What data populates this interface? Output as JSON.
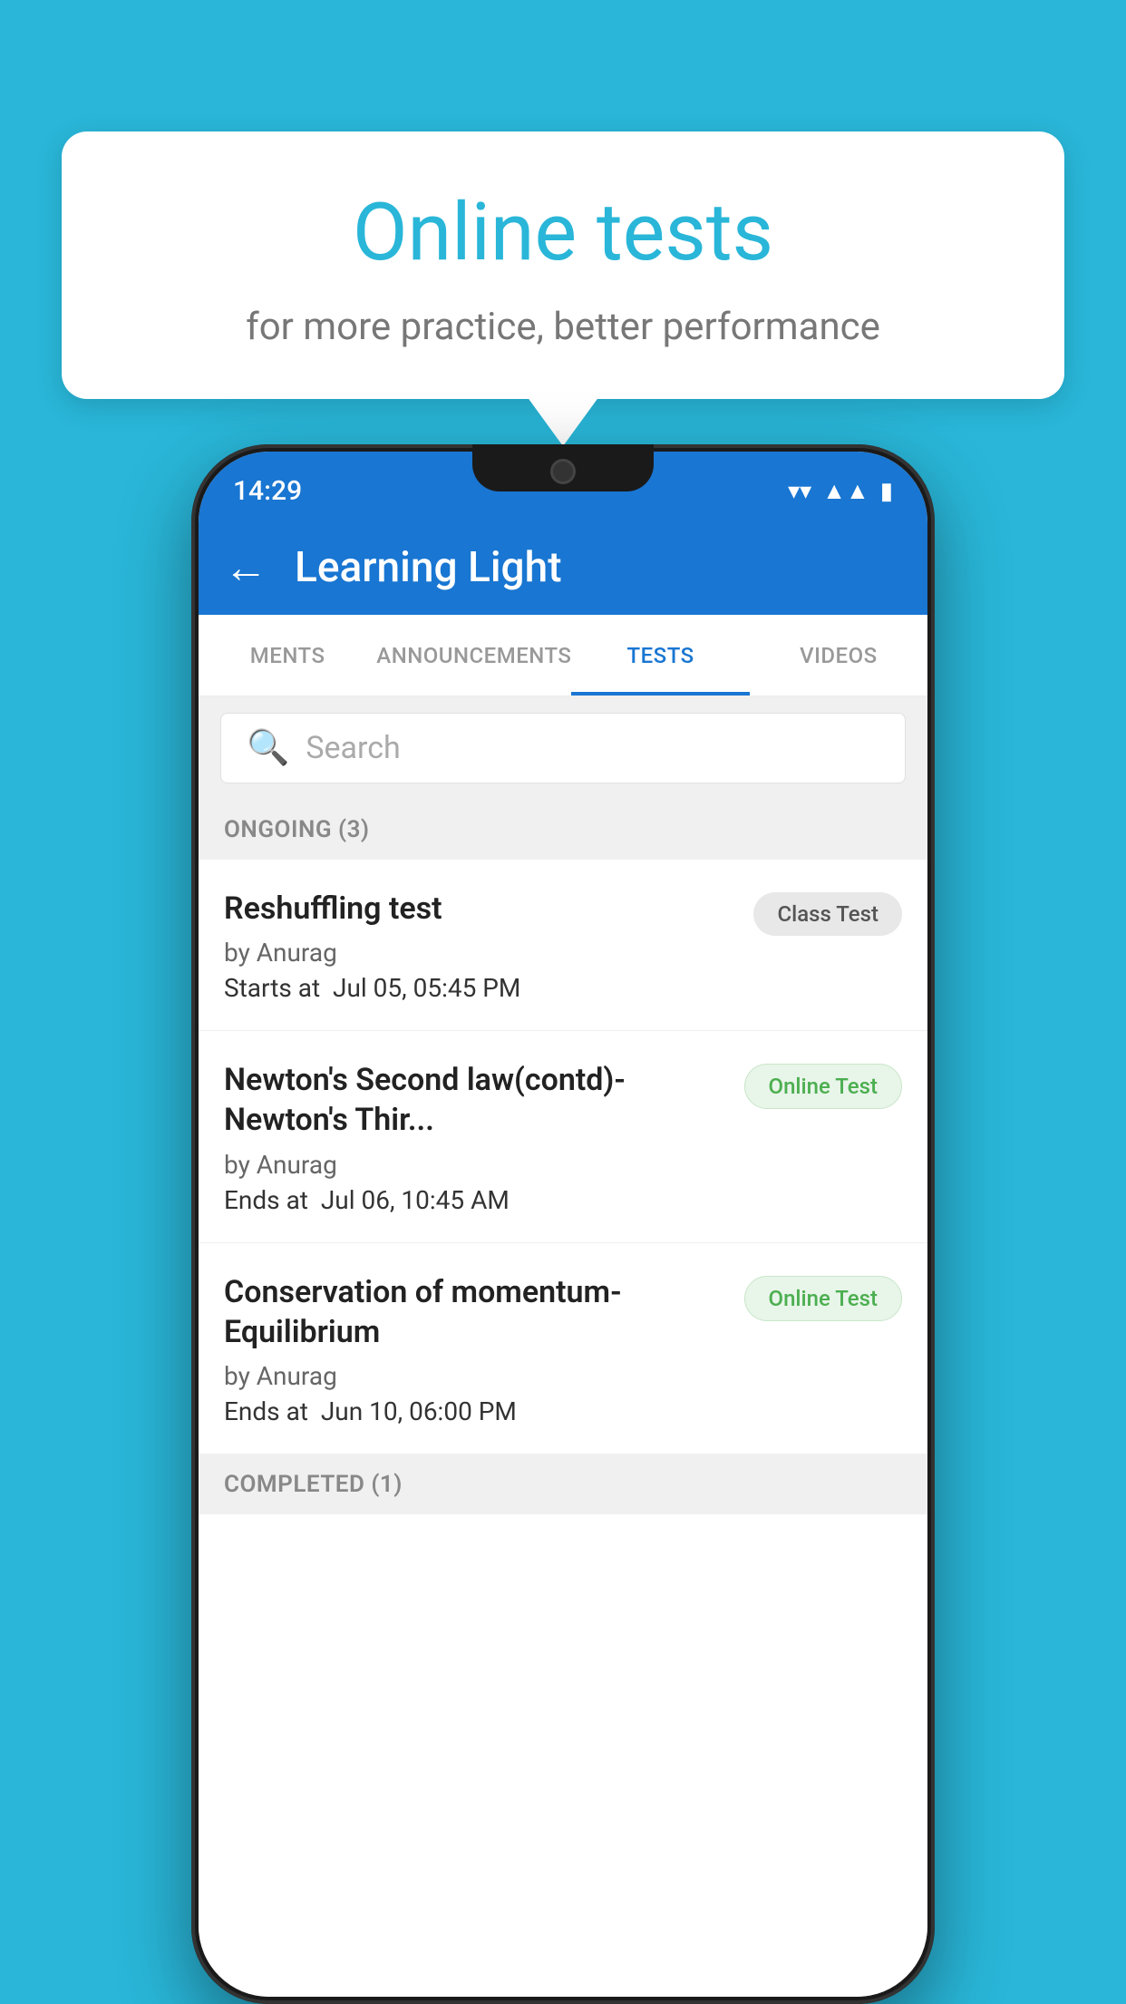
{
  "background_color": "#29b6d8",
  "bubble": {
    "title": "Online tests",
    "subtitle": "for more practice, better performance"
  },
  "phone": {
    "status_bar": {
      "time": "14:29",
      "icons": [
        "wifi",
        "signal",
        "battery"
      ]
    },
    "app_bar": {
      "title": "Learning Light",
      "back_label": "←"
    },
    "tabs": [
      {
        "label": "MENTS",
        "active": false
      },
      {
        "label": "ANNOUNCEMENTS",
        "active": false
      },
      {
        "label": "TESTS",
        "active": true
      },
      {
        "label": "VIDEOS",
        "active": false
      }
    ],
    "search": {
      "placeholder": "Search"
    },
    "ongoing_section": {
      "label": "ONGOING (3)"
    },
    "tests": [
      {
        "name": "Reshuffling test",
        "author": "by Anurag",
        "date_label": "Starts at",
        "date": "Jul 05, 05:45 PM",
        "badge": "Class Test",
        "badge_type": "class"
      },
      {
        "name": "Newton's Second law(contd)-Newton's Thir...",
        "author": "by Anurag",
        "date_label": "Ends at",
        "date": "Jul 06, 10:45 AM",
        "badge": "Online Test",
        "badge_type": "online"
      },
      {
        "name": "Conservation of momentum-Equilibrium",
        "author": "by Anurag",
        "date_label": "Ends at",
        "date": "Jun 10, 06:00 PM",
        "badge": "Online Test",
        "badge_type": "online"
      }
    ],
    "completed_section": {
      "label": "COMPLETED (1)"
    }
  }
}
